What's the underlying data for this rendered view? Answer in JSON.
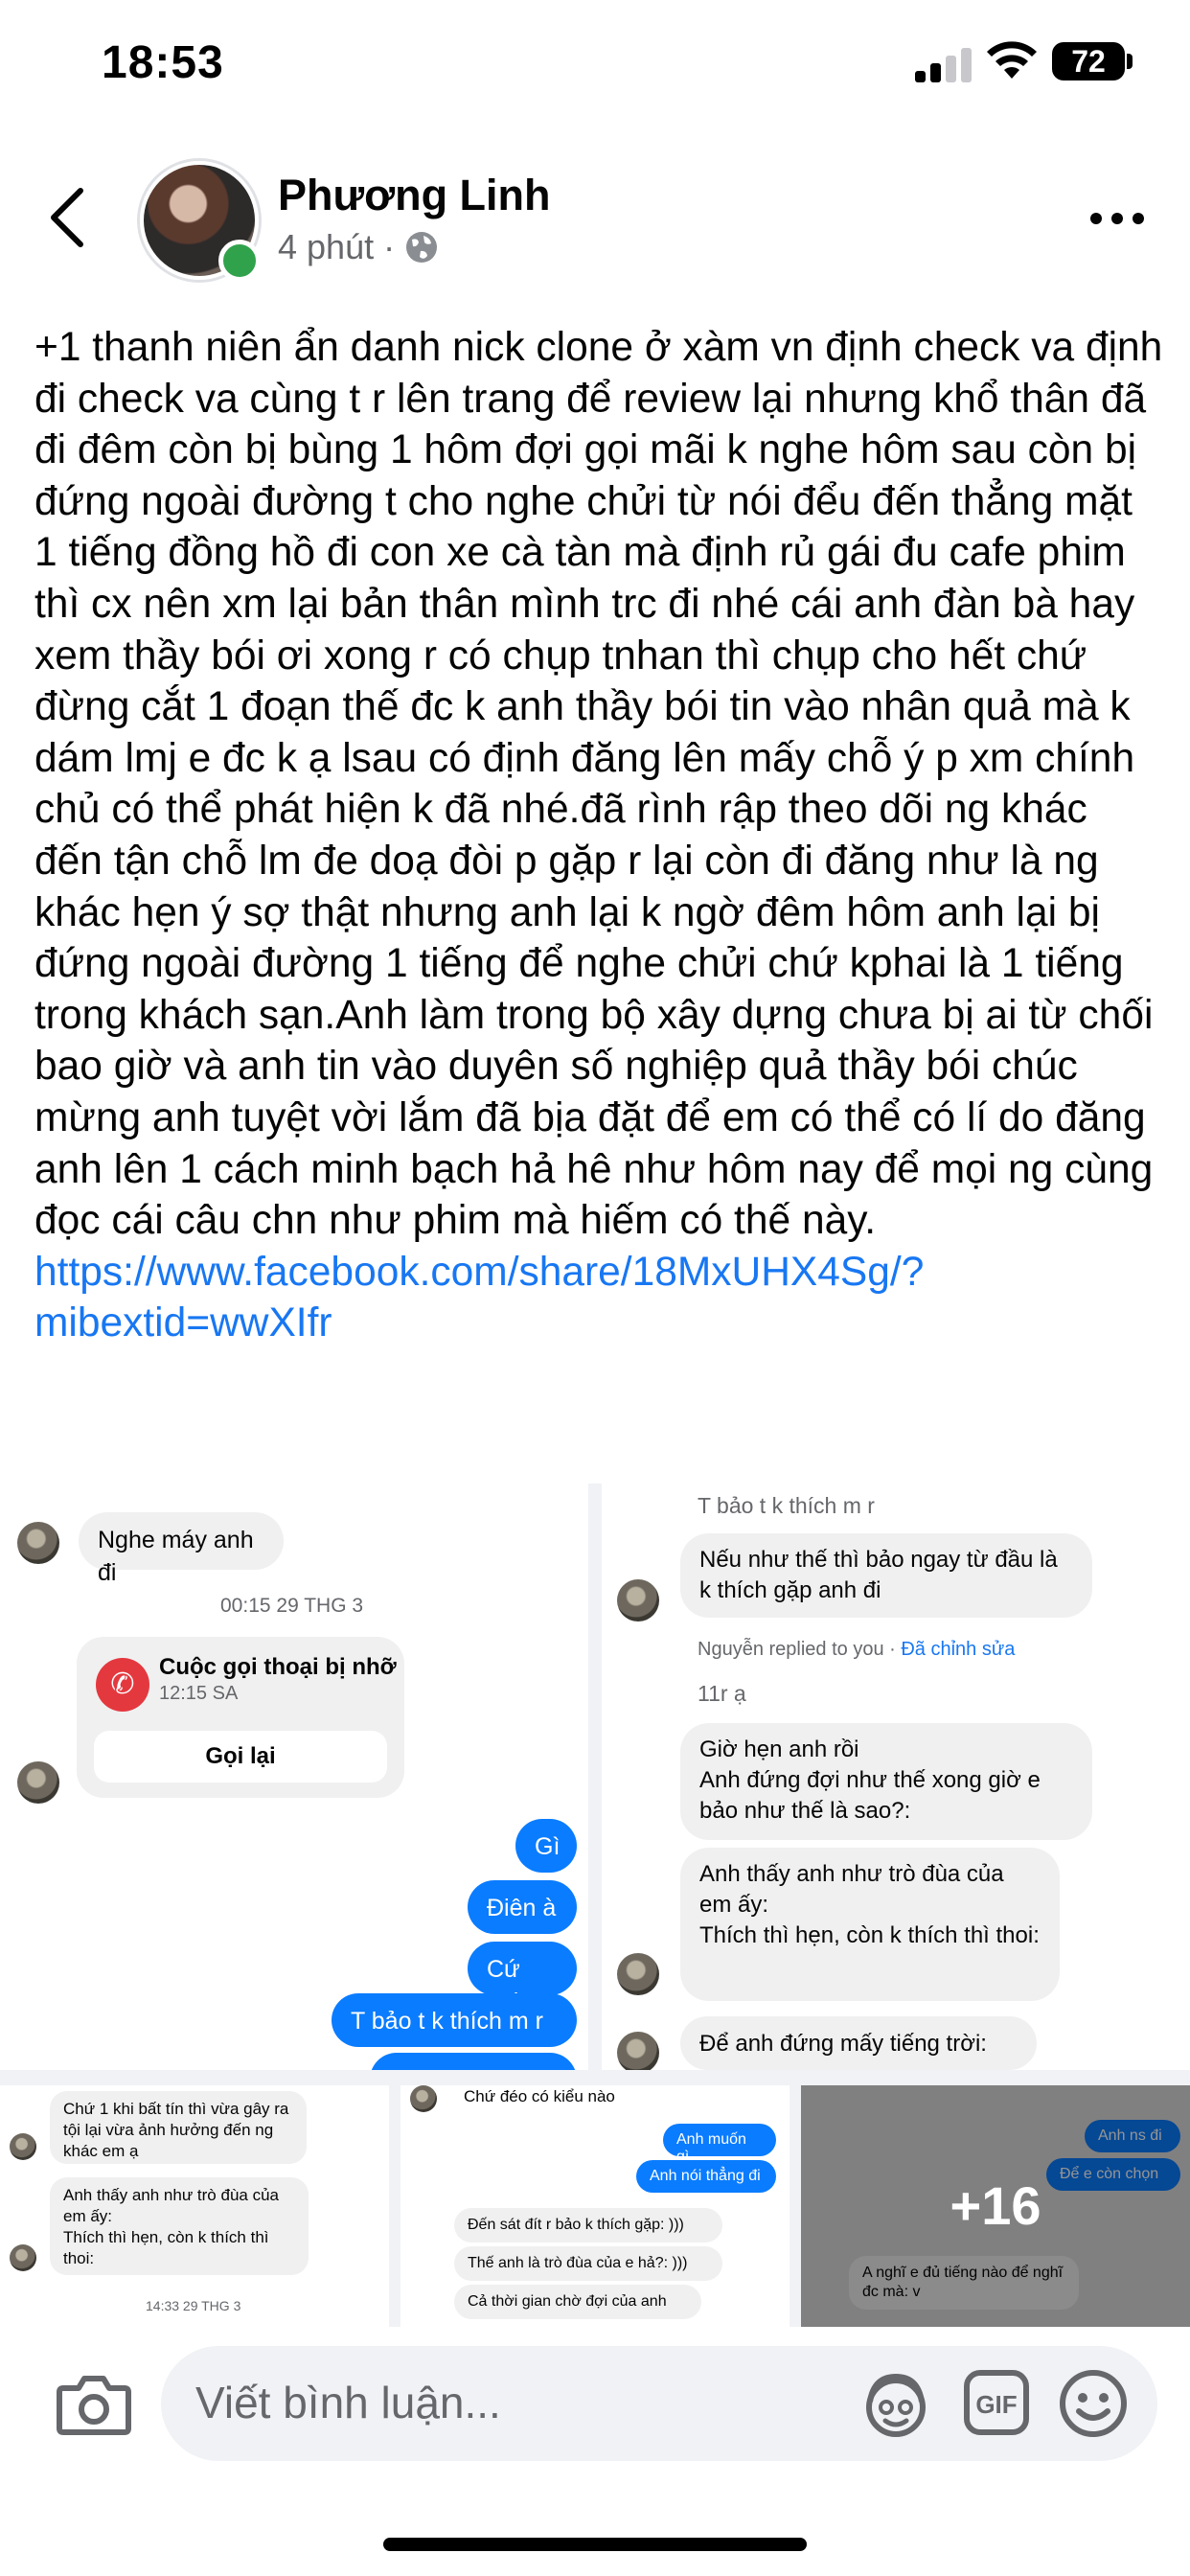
{
  "status_bar": {
    "time": "18:53",
    "battery": "72"
  },
  "post": {
    "author": "Phương Linh",
    "time_ago": "4 phút",
    "separator": "·",
    "text": "+1 thanh niên ẩn danh nick clone ở xàm vn định check va định đi check va cùng t r lên trang để review lại nhưng khổ thân đã đi đêm còn bị bùng 1 hôm đợi gọi mãi k nghe hôm sau còn bị đứng ngoài đường t cho nghe chửi từ nói đểu đến thẳng mặt 1 tiếng đồng hồ đi con xe cà tàn mà định rủ gái đu cafe phim thì cx nên xm lại bản thân mình trc đi nhé cái anh đàn bà hay xem thầy bói ơi xong r có chụp tnhan thì chụp cho hết chứ đừng cắt 1 đoạn thế đc k anh thầy bói tin vào nhân quả mà k dám lmj e đc k ạ lsau có định đăng lên mấy chỗ ý p xm chính chủ có thể phát hiện k đã nhé.đã rình rập theo dõi ng khác đến tận chỗ lm đe doạ đòi p gặp r lại còn đi đăng như là ng khác hẹn ý sợ thật nhưng anh lại k ngờ đêm hôm anh lại bị đứng ngoài đường 1 tiếng để nghe chửi chứ kphai là 1 tiếng trong khách sạn.Anh làm trong bộ xây dựng chưa bị ai từ chối bao giờ và anh tin vào duyên số nghiệp quả thầy bói chúc mừng anh tuyệt vời lắm đã bịa đặt để em có thể có lí do đăng anh lên 1 cách minh bạch hả hê như hôm nay để mọi ng cùng đọc cái câu chn như phim mà hiếm có thế này.",
    "link": "https://www.facebook.com/share/18MxUHX4Sg/?mibextid=wwXIfr",
    "link_display": "https://\nwww.facebook.com/share/18MxUHX4Sg/?\nmibextid=wwXIfr"
  },
  "images": {
    "tile1": {
      "msg1": "Nghe máy anh đi",
      "timestamp": "00:15 29 THG 3",
      "call_title": "Cuộc gọi thoại bị nhỡ",
      "call_time": "12:15 SA",
      "call_button": "Gọi lại",
      "blue1": "Gì",
      "blue2": "Điên à",
      "blue3": "Cứ gọi",
      "blue4": "T bảo t k thích m r"
    },
    "tile2": {
      "quoted": "T bảo t k thích m r",
      "msg1": "Nếu như thế thì bảo ngay từ đầu là k thích gặp anh đi",
      "reply_label": "Nguyễn replied to you",
      "edited": "Đã chỉnh sửa",
      "msg2": "11r ạ",
      "msg3": "Giờ hẹn anh rồi\nAnh đứng đợi như thế xong giờ e bảo như thế là sao?:",
      "msg4": "Anh thấy anh như trò đùa của em ấy:\nThích thì hẹn, còn k thích thì thoi:",
      "msg5": "Để anh đứng mấy tiếng trời:"
    },
    "tile3": {
      "msg1": "Chứ 1 khi bất tín thì vừa gây ra tội lại vừa ảnh hưởng đến ng khác em ạ",
      "msg2": "Anh thấy anh như trò đùa của em ấy:\nThích thì hẹn, còn k thích thì thoi:",
      "timestamp": "14:33 29 THG 3"
    },
    "tile4": {
      "msg1": "Chứ đéo có kiểu nào",
      "blue1": "Anh muốn gì",
      "blue2": "Anh nói thẳng đi",
      "msg2": "Đến sát đít r bảo k thích gặp: )))",
      "msg3": "Thế anh là trò đùa của e hả?: )))",
      "msg4": "Cả thời gian chờ đợi của anh"
    },
    "tile5": {
      "more_count": "+16",
      "msg1": "Anh ns đi",
      "msg2": "Để e còn chọn",
      "msg3": "A nghĩ e đủ tiếng nào để nghĩ đc mà: v"
    }
  },
  "comment": {
    "placeholder": "Viết bình luận..."
  },
  "icons": [
    "signal-icon",
    "wifi-icon",
    "battery-icon",
    "back-arrow-icon",
    "globe-icon",
    "more-options-icon",
    "camera-icon",
    "avatar-sticker-icon",
    "gif-icon",
    "emoji-icon"
  ]
}
